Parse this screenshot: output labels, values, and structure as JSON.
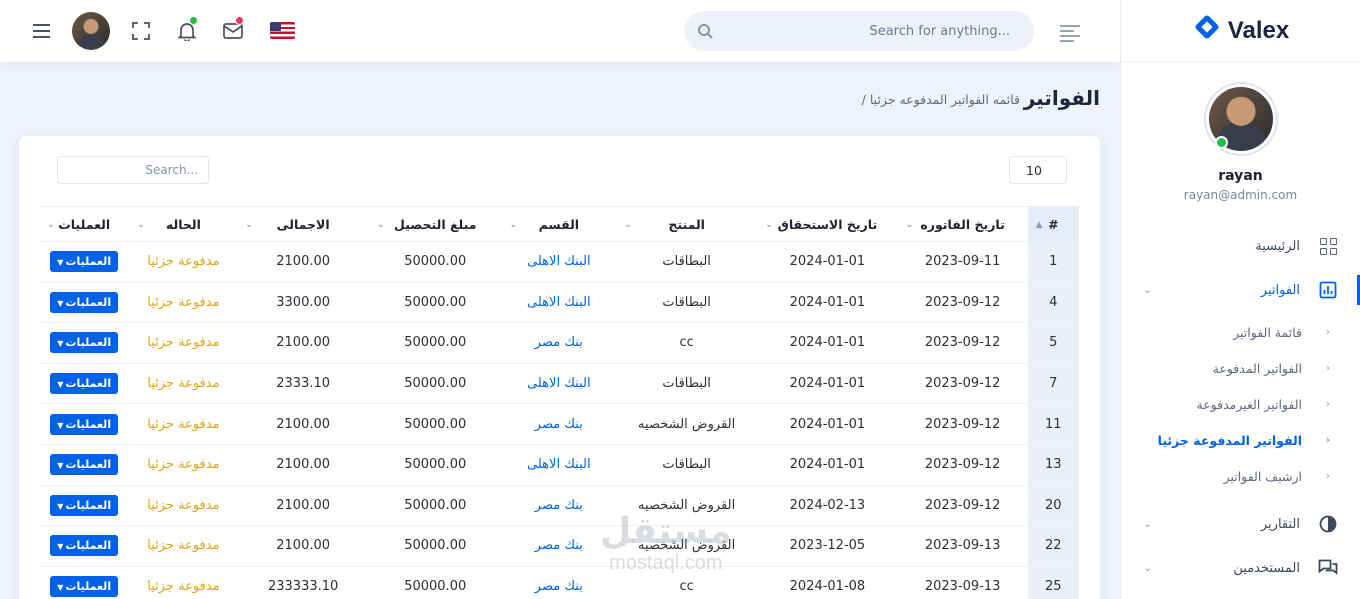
{
  "brand": {
    "name": "Valex"
  },
  "header": {
    "search_placeholder": "Search for anything...",
    "notif_dot_color": "#22c03c",
    "mail_dot_color": "#ee335e"
  },
  "profile": {
    "name": "rayan",
    "email": "rayan@admin.com"
  },
  "menu": {
    "home": "الرئيسية",
    "invoices": "الفواتير",
    "sub": [
      "قائمة الفواتير",
      "الفواتير المدفوعة",
      "الفواتير الغيرمدفوعة",
      "الفواتير المدفوعة جزئيا",
      "ارشيف الفواتير"
    ],
    "reports": "التقارير",
    "users": "المستخدمين"
  },
  "page": {
    "title": "الفواتير",
    "breadcrumb": "/ قائمه الفواتير المدفوعه جزئيا"
  },
  "table_controls": {
    "page_length": "10",
    "search_placeholder": "Search..."
  },
  "table": {
    "headers": [
      "#",
      "تاريخ الفاتوره",
      "تاريخ الاستحقاق",
      "المنتج",
      "القسم",
      "مبلغ التحصيل",
      "الاجمالى",
      "الحاله",
      "العمليات"
    ],
    "button_label": "العمليات",
    "rows": [
      [
        "1",
        "2023-09-11",
        "2024-01-01",
        "البطاقات",
        "البنك الاهلى",
        "50000.00",
        "2100.00",
        "مدفوعة جزئيا"
      ],
      [
        "4",
        "2023-09-12",
        "2024-01-01",
        "البطاقات",
        "البنك الاهلى",
        "50000.00",
        "3300.00",
        "مدفوعة جزئيا"
      ],
      [
        "5",
        "2023-09-12",
        "2024-01-01",
        "cc",
        "بنك مصر",
        "50000.00",
        "2100.00",
        "مدفوعة جزئيا"
      ],
      [
        "7",
        "2023-09-12",
        "2024-01-01",
        "البطاقات",
        "البنك الاهلى",
        "50000.00",
        "2333.10",
        "مدفوعة جزئيا"
      ],
      [
        "11",
        "2023-09-12",
        "2024-01-01",
        "القروض الشخصيه",
        "بنك مصر",
        "50000.00",
        "2100.00",
        "مدفوعة جزئيا"
      ],
      [
        "13",
        "2023-09-12",
        "2024-01-01",
        "البطاقات",
        "البنك الاهلى",
        "50000.00",
        "2100.00",
        "مدفوعة جزئيا"
      ],
      [
        "20",
        "2023-09-12",
        "2024-02-13",
        "القروض الشخصيه",
        "بنك مصر",
        "50000.00",
        "2100.00",
        "مدفوعة جزئيا"
      ],
      [
        "22",
        "2023-09-13",
        "2023-12-05",
        "القروض الشخصيه",
        "بنك مصر",
        "50000.00",
        "2100.00",
        "مدفوعة جزئيا"
      ],
      [
        "25",
        "2023-09-13",
        "2024-01-08",
        "cc",
        "بنك مصر",
        "50000.00",
        "233333.10",
        "مدفوعة جزئيا"
      ]
    ]
  },
  "watermark": {
    "line1": "مستقل",
    "line2": "mostaql.com"
  },
  "colors": {
    "accent": "#0162e8",
    "status": "#e0a418",
    "online": "#22c03c"
  }
}
